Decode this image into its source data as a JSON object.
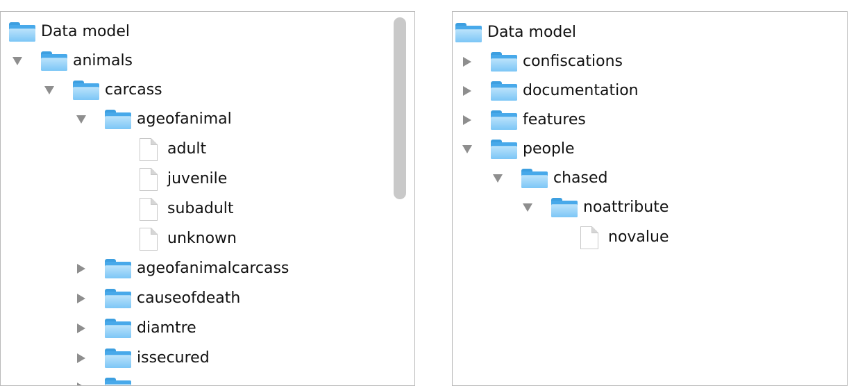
{
  "left_tree": {
    "root": "Data model",
    "animals": "animals",
    "carcass": "carcass",
    "ageofanimal": "ageofanimal",
    "adult": "adult",
    "juvenile": "juvenile",
    "subadult": "subadult",
    "unknown": "unknown",
    "ageofanimalcarcass": "ageofanimalcarcass",
    "causeofdeath": "causeofdeath",
    "diamtre": "diamtre",
    "issecured": "issecured"
  },
  "right_tree": {
    "root": "Data model",
    "confiscations": "confiscations",
    "documentation": "documentation",
    "features": "features",
    "people": "people",
    "chased": "chased",
    "noattribute": "noattribute",
    "novalue": "novalue"
  },
  "icons": {
    "folder": "folder-icon",
    "file": "file-icon",
    "expanded": "triangle-down-icon",
    "collapsed": "triangle-right-icon"
  },
  "colors": {
    "folder": "#48a9ea",
    "folder_light": "#b9e2fb",
    "arrow": "#8e8e8e",
    "scrollbar": "#c9c9c9",
    "border": "#b9b9b9"
  }
}
